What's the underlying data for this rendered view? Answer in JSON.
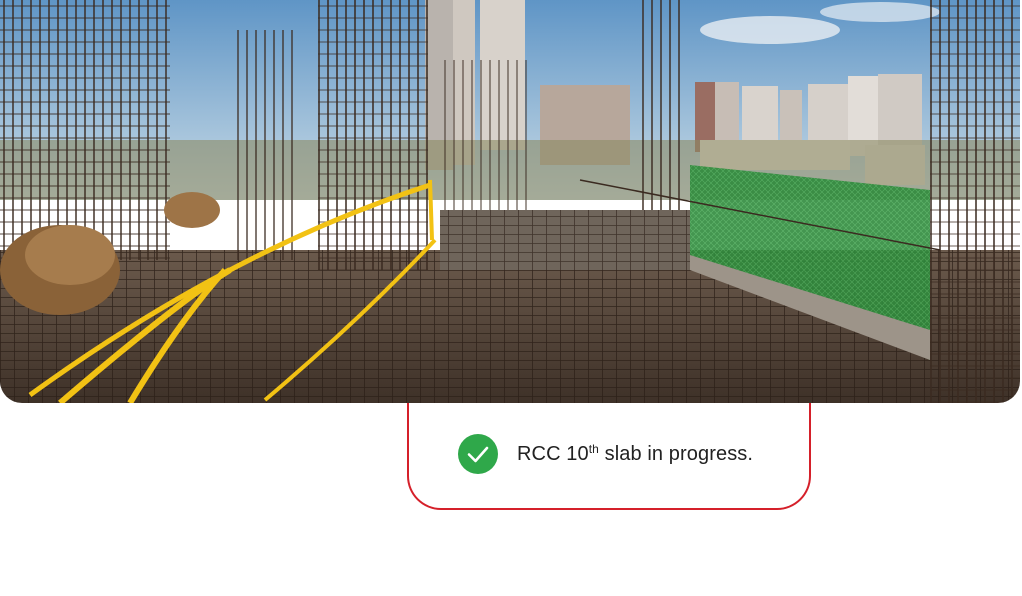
{
  "photo": {
    "description_icon": "construction-site-photo",
    "sky_color": "#8fb8d8",
    "rebar_color": "#3a2a20",
    "rope_color": "#f2c214",
    "net_color": "#2f8a3c"
  },
  "status": {
    "icon": "check-circle-icon",
    "icon_color": "#2fa84a",
    "text_prefix": "RCC 10",
    "text_sup": "th",
    "text_suffix": " slab in progress.",
    "border_color": "#d5202a"
  }
}
